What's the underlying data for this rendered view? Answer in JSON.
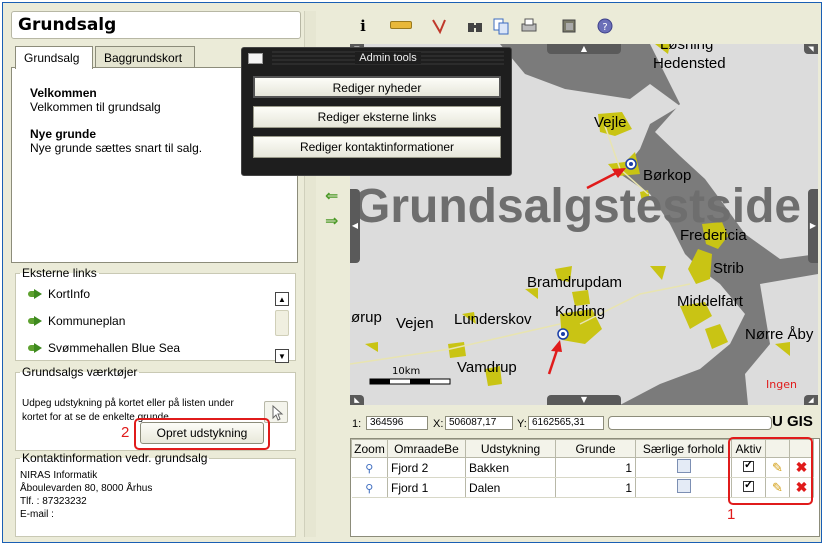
{
  "app": {
    "title": "Grundsalg"
  },
  "tabs": [
    {
      "label": "Grundsalg"
    },
    {
      "label": "Baggrundskort"
    }
  ],
  "welcome": {
    "heading": "Velkommen",
    "text": "Velkommen til grundsalg",
    "heading2": "Nye grunde",
    "text2": "Nye grunde sættes snart til salg."
  },
  "external_links": {
    "legend": "Eksterne links",
    "items": [
      {
        "label": "KortInfo"
      },
      {
        "label": "Kommuneplan"
      },
      {
        "label": "Svømmehallen Blue Sea"
      }
    ]
  },
  "tools": {
    "legend": "Grundsalgs værktøjer",
    "description": "Udpeg udstykning på kortet eller på listen under kortet for at se de enkelte grunde.",
    "create_button": "Opret udstykning",
    "callout_number": "2"
  },
  "contact": {
    "legend": "Kontaktinformation vedr. grundsalg",
    "lines": [
      "NIRAS Informatik",
      "Åboulevarden 80, 8000 Århus",
      "Tlf. : 87323232",
      "E-mail :"
    ]
  },
  "admin": {
    "title": "Admin tools",
    "buttons": [
      "Rediger nyheder",
      "Rediger eksterne links",
      "Rediger kontaktinformationer"
    ]
  },
  "map": {
    "watermark": "Grundsalgstestside",
    "places": [
      "Løsning",
      "Hedensted",
      "Vejle",
      "Børkop",
      "Fredericia",
      "Strib",
      "Bramdrupdam",
      "Middelfart",
      "Kolding",
      "Lunderskov",
      "Vejen",
      "ørup",
      "Nørre Åby",
      "Vamdrup"
    ],
    "scale_label": "10km",
    "corner_label": "Ingen",
    "colors": {
      "water": "#7b7b7b",
      "land": "#dcdcdc",
      "urban": "#c9c414",
      "arrow": "#e01b1b"
    }
  },
  "coords": {
    "label1": "1:",
    "value1": "364596",
    "label_x": "X:",
    "value_x": "506087,17",
    "label_y": "Y:",
    "value_y": "6162565,31",
    "brand": "U GIS"
  },
  "grid": {
    "columns": [
      "Zoom",
      "OmraadeBe",
      "Udstykning",
      "Grunde",
      "Særlige forhold",
      "Aktiv",
      "",
      ""
    ],
    "rows": [
      {
        "area": "Fjord 2",
        "subdivision": "Bakken",
        "plots": "1"
      },
      {
        "area": "Fjord 1",
        "subdivision": "Dalen",
        "plots": "1"
      }
    ],
    "callout_number": "1"
  }
}
